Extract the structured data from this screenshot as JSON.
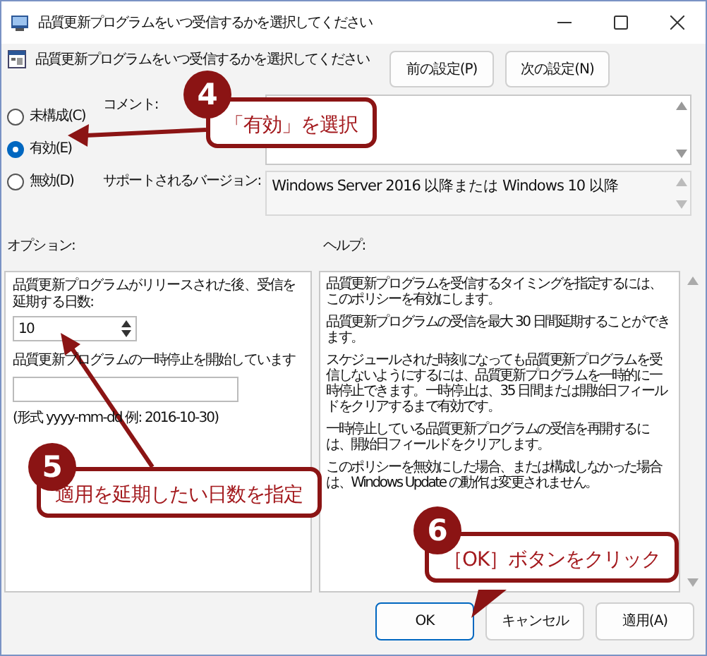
{
  "window": {
    "title": "品質更新プログラムをいつ受信するかを選択してください"
  },
  "header": {
    "title": "品質更新プログラムをいつ受信するかを選択してください"
  },
  "nav_buttons": [
    "前の設定(P)",
    "次の設定(N)"
  ],
  "state_options": [
    {
      "label": "未構成(C)",
      "selected": false
    },
    {
      "label": "有効(E)",
      "selected": true
    },
    {
      "label": "無効(D)",
      "selected": false
    }
  ],
  "comment": {
    "label": "コメント:"
  },
  "supported": {
    "label": "サポートされるバージョン:",
    "value": "Windows Server 2016 以降または Windows 10 以降"
  },
  "options": {
    "label": "オプション:",
    "deferral_label": "品質更新プログラムがリリースされた後、受信を延期する日数:",
    "deferral_value": "10",
    "pause_label": "品質更新プログラムの一時停止を開始しています",
    "format_hint": "(形式 yyyy-mm-dd 例: 2016-10-30)"
  },
  "help": {
    "label": "ヘルプ:",
    "paragraphs": [
      "品質更新プログラムを受信するタイミングを指定するには、このポリシーを有効にします。",
      "品質更新プログラムの受信を最大 30 日間延期することができます。",
      "スケジュールされた時刻になっても品質更新プログラムを受信しないようにするには、品質更新プログラムを一時的に一時停止できます。一時停止は、35 日間または開始日フィールドをクリアするまで有効です。",
      "一時停止している品質更新プログラムの受信を再開するには、開始日フィールドをクリアします。",
      "このポリシーを無効にした場合、または構成しなかった場合は、Windows Update の動作は変更されません。"
    ]
  },
  "footer_buttons": [
    {
      "label": "OK",
      "default": true
    },
    {
      "label": "キャンセル",
      "default": false
    },
    {
      "label": "適用(A)",
      "default": false
    }
  ],
  "callouts": [
    {
      "number": "4",
      "text": "「有効」を選択"
    },
    {
      "number": "5",
      "text": "適用を延期したい日数を指定"
    },
    {
      "number": "6",
      "text": "［OK］ボタンをクリック"
    }
  ]
}
